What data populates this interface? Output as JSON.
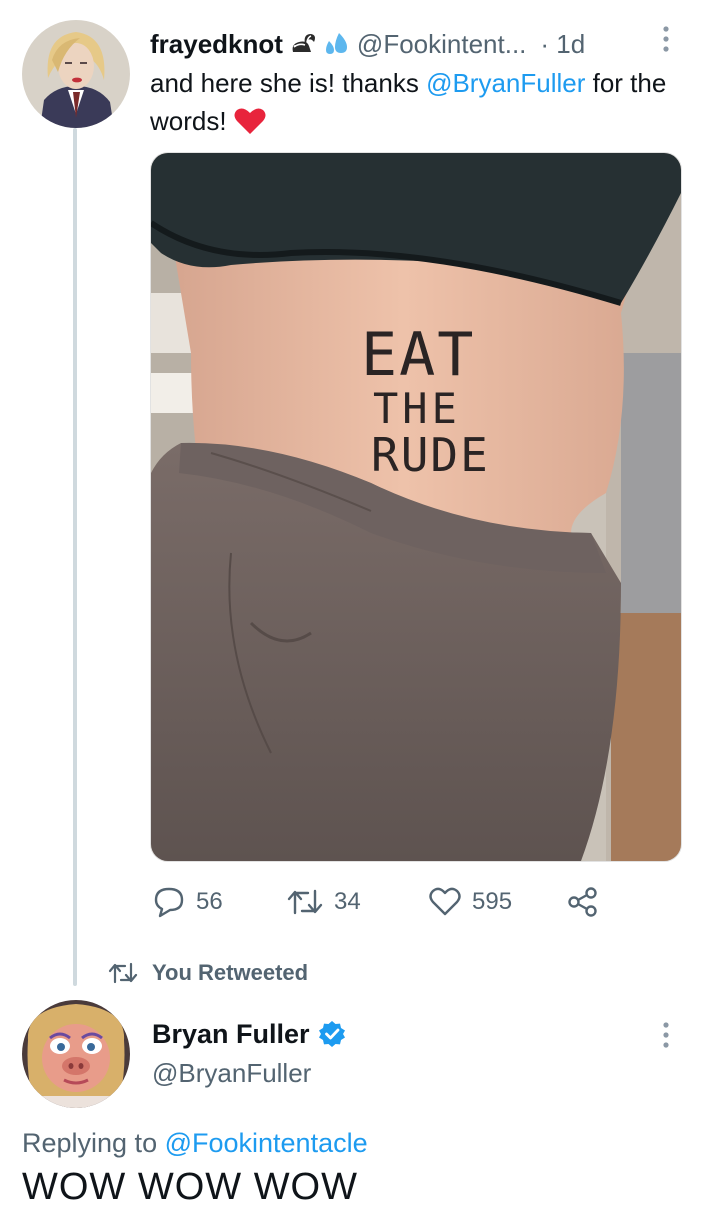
{
  "tweet": {
    "display_name": "frayedknot",
    "handle": "@Fookintent...",
    "time": "· 1d",
    "text_before_mention": "and here she is! thanks ",
    "mention": "@BryanFuller",
    "text_after_mention": " for the words!",
    "media": {
      "tattoo_line1": "EAT",
      "tattoo_line2": "THE",
      "tattoo_line3": "RUDE"
    },
    "actions": {
      "replies": "56",
      "retweets": "34",
      "likes": "595"
    }
  },
  "retweet_context": {
    "label": "You Retweeted"
  },
  "reply": {
    "display_name": "Bryan Fuller",
    "handle": "@BryanFuller",
    "replying_prefix": "Replying to ",
    "replying_to": "@Fookintentacle",
    "text_partial": "WOW WOW WOW"
  },
  "colors": {
    "link": "#1d9bf0",
    "secondary_text": "#536471",
    "heart": "#e8243c",
    "verified": "#1d9bf0"
  }
}
